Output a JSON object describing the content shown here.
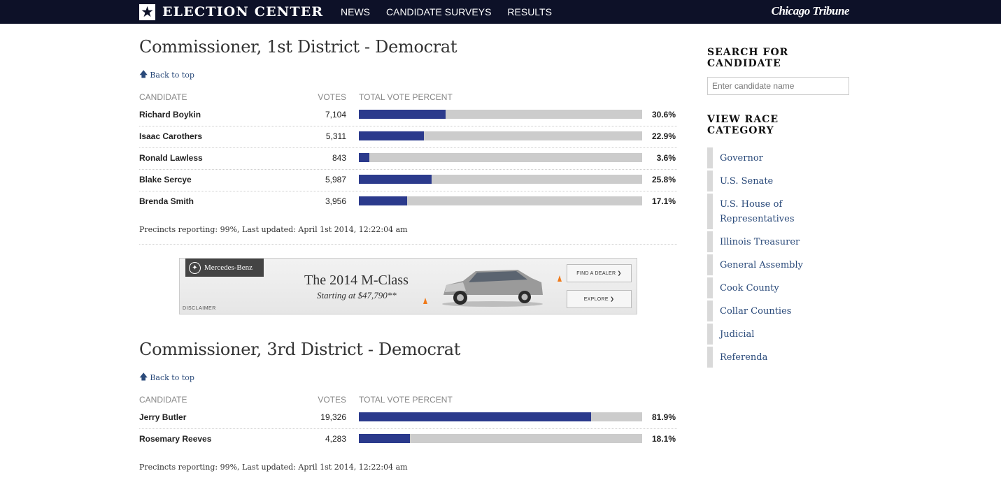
{
  "header": {
    "title": "ELECTION CENTER",
    "nav": [
      "NEWS",
      "CANDIDATE SURVEYS",
      "RESULTS"
    ],
    "publisher": "Chicago Tribune"
  },
  "races": [
    {
      "title": "Commissioner, 1st District - Democrat",
      "back_to_top": "Back to top",
      "col_candidate": "CANDIDATE",
      "col_votes": "VOTES",
      "col_pct": "TOTAL VOTE PERCENT",
      "candidates": [
        {
          "name": "Richard Boykin",
          "votes": "7,104",
          "pct_label": "30.6%",
          "pct": 30.6
        },
        {
          "name": "Isaac Carothers",
          "votes": "5,311",
          "pct_label": "22.9%",
          "pct": 22.9
        },
        {
          "name": "Ronald Lawless",
          "votes": "843",
          "pct_label": "3.6%",
          "pct": 3.6
        },
        {
          "name": "Blake Sercye",
          "votes": "5,987",
          "pct_label": "25.8%",
          "pct": 25.8
        },
        {
          "name": "Brenda Smith",
          "votes": "3,956",
          "pct_label": "17.1%",
          "pct": 17.1
        }
      ],
      "precincts": "Precincts reporting: 99%, Last updated: April 1st 2014, 12:22:04 am"
    },
    {
      "title": "Commissioner, 3rd District - Democrat",
      "back_to_top": "Back to top",
      "col_candidate": "CANDIDATE",
      "col_votes": "VOTES",
      "col_pct": "TOTAL VOTE PERCENT",
      "candidates": [
        {
          "name": "Jerry Butler",
          "votes": "19,326",
          "pct_label": "81.9%",
          "pct": 81.9
        },
        {
          "name": "Rosemary Reeves",
          "votes": "4,283",
          "pct_label": "18.1%",
          "pct": 18.1
        }
      ],
      "precincts": "Precincts reporting: 99%, Last updated: April 1st 2014, 12:22:04 am"
    }
  ],
  "ad": {
    "brand": "Mercedes-Benz",
    "headline": "The 2014 M-Class",
    "subline": "Starting at $47,790**",
    "btn_dealer": "FIND A DEALER ❯",
    "btn_explore": "EXPLORE ❯",
    "disclaimer": "DISCLAIMER"
  },
  "sidebar": {
    "search_heading": "SEARCH FOR CANDIDATE",
    "search_placeholder": "Enter candidate name",
    "category_heading": "VIEW RACE CATEGORY",
    "categories": [
      "Governor",
      "U.S. Senate",
      "U.S. House of Representatives",
      "Illinois Treasurer",
      "General Assembly",
      "Cook County",
      "Collar Counties",
      "Judicial",
      "Referenda"
    ]
  },
  "colors": {
    "topbar": "#0d1128",
    "bar_fill": "#2b3a8c",
    "bar_track": "#cccccc",
    "link": "#2a4a7a"
  }
}
